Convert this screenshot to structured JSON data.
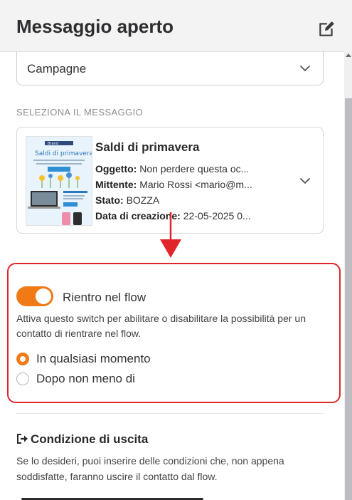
{
  "header": {
    "title": "Messaggio aperto",
    "edit_icon": "edit-pencil-icon"
  },
  "campaign_select": {
    "value": "Campagne"
  },
  "message_section": {
    "label": "SELEZIONA IL MESSAGGIO",
    "card": {
      "title": "Saldi di primavera",
      "subject_label": "Oggetto:",
      "subject_value": "Non perdere questa oc...",
      "sender_label": "Mittente:",
      "sender_value": "Mario Rossi <mario@m...",
      "status_label": "Stato:",
      "status_value": "BOZZA",
      "created_label": "Data di creazione:",
      "created_value": "22-05-2025 0...",
      "thumbnail": {
        "brand": "Brand",
        "headline": "Saldi di primavera"
      }
    }
  },
  "reentry": {
    "toggle_on": true,
    "label": "Rientro nel flow",
    "help": "Attiva questo switch per abilitare o disabilitare la possibilità per un contatto di rientrare nel flow.",
    "options": [
      {
        "label": "In qualsiasi momento",
        "selected": true
      },
      {
        "label": "Dopo non meno di",
        "selected": false
      }
    ]
  },
  "exit": {
    "title": "Condizione di uscita",
    "text": "Se lo desideri, puoi inserire delle condizioni che, non appena soddisfatte, faranno uscire il contatto dal flow."
  },
  "colors": {
    "accent": "#ef7a16",
    "highlight": "#e0262b"
  }
}
